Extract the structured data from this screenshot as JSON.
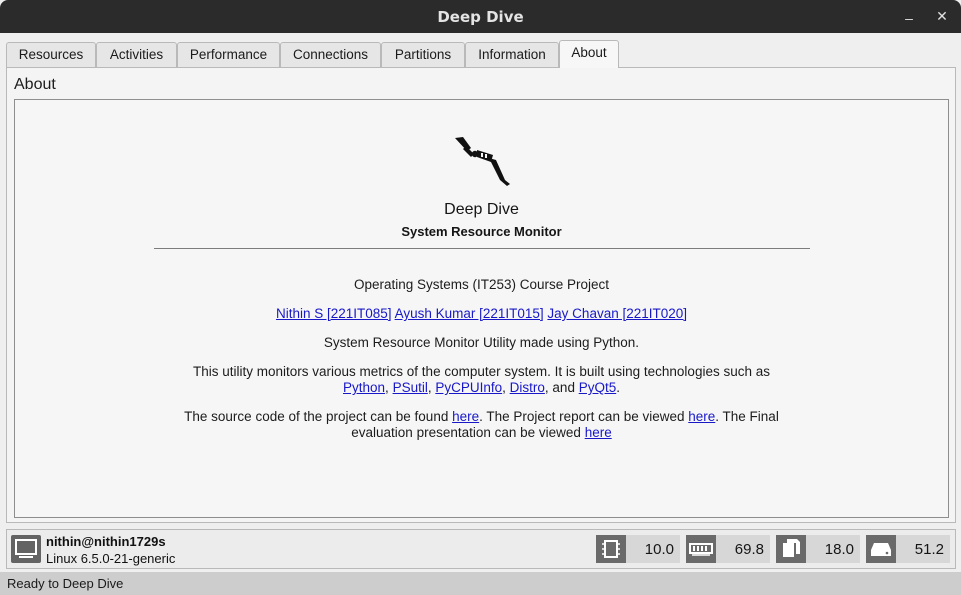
{
  "window": {
    "title": "Deep Dive",
    "minimize_glyph": "–",
    "close_glyph": "✕"
  },
  "tabs": [
    {
      "label": "Resources"
    },
    {
      "label": "Activities"
    },
    {
      "label": "Performance"
    },
    {
      "label": "Connections"
    },
    {
      "label": "Partitions"
    },
    {
      "label": "Information"
    },
    {
      "label": "About",
      "active": true
    }
  ],
  "about": {
    "pane_title": "About",
    "logo_icon": "scuba-diver-icon",
    "app_name": "Deep Dive",
    "app_subtitle": "System Resource Monitor",
    "course": "Operating Systems (IT253) Course Project",
    "authors": [
      "Nithin S [221IT085]",
      "Ayush Kumar [221IT015]",
      "Jay Chavan [221IT020]"
    ],
    "description": "System Resource Monitor Utility made using Python.",
    "tech_intro": "This utility monitors various metrics of the computer system. It is built using technologies such as",
    "technologies": [
      "Python",
      "PSutil",
      "PyCPUInfo",
      "Distro",
      "PyQt5"
    ],
    "tech_sep1": ", ",
    "tech_and": ", and ",
    "tech_end": ".",
    "source_text_1": "The source code of the project can be found ",
    "source_link": "here",
    "source_text_2": ". The Project report can be viewed ",
    "report_link": "here",
    "source_text_3": ". The Final",
    "eval_text": "evaluation presentation can be viewed ",
    "eval_link": "here"
  },
  "status": {
    "user": "nithin@nithin1729s",
    "kernel": "Linux 6.5.0-21-generic",
    "stats": [
      {
        "icon": "cpu-icon",
        "value": "10.0"
      },
      {
        "icon": "memory-icon",
        "value": "69.8"
      },
      {
        "icon": "swap-icon",
        "value": "18.0"
      },
      {
        "icon": "disk-icon",
        "value": "51.2"
      }
    ]
  },
  "footer": {
    "message": "Ready to Deep Dive"
  }
}
